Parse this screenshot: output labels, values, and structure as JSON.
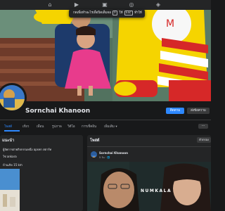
{
  "topbar": {
    "icons": [
      "home-icon",
      "video-icon",
      "marketplace-icon",
      "groups-icon",
      "gaming-icon"
    ]
  },
  "toast": {
    "text_before": "กดเพื่อทำอะไรเพื่อปิดเต็มจอ",
    "key1": "F",
    "middle": "ให้",
    "key2": "Esc",
    "text_after": "ทำให้"
  },
  "profile": {
    "name": "Sornchai Khanoon",
    "primary_button": "ติดตาม",
    "secondary_button": "ส่งข้อความ"
  },
  "tabs": {
    "items": [
      "โพสต์",
      "เกี่ยว",
      "เพื่อน",
      "รูปภาพ",
      "วิดีโอ",
      "การเช็คอิน",
      "เพิ่มเติม ▾"
    ],
    "more": "···"
  },
  "intro": {
    "title": "แนะนำ",
    "lines": [
      "ผู้จัดการฝ่ายกิจกรรมหนึ่ง apsen สตาร์ท",
      "ใช่ ankara",
      "บ้านเกิด 15 km"
    ]
  },
  "posts": {
    "title": "โพสต์",
    "filter_button": "ตัวกรอง",
    "author": "Sornchai Khanoon",
    "time": "5 วัน · 🌐",
    "image_text": "NUMKALA"
  },
  "colors": {
    "accent": "#2d88ff",
    "background": "#18191a",
    "panel": "#242526"
  }
}
